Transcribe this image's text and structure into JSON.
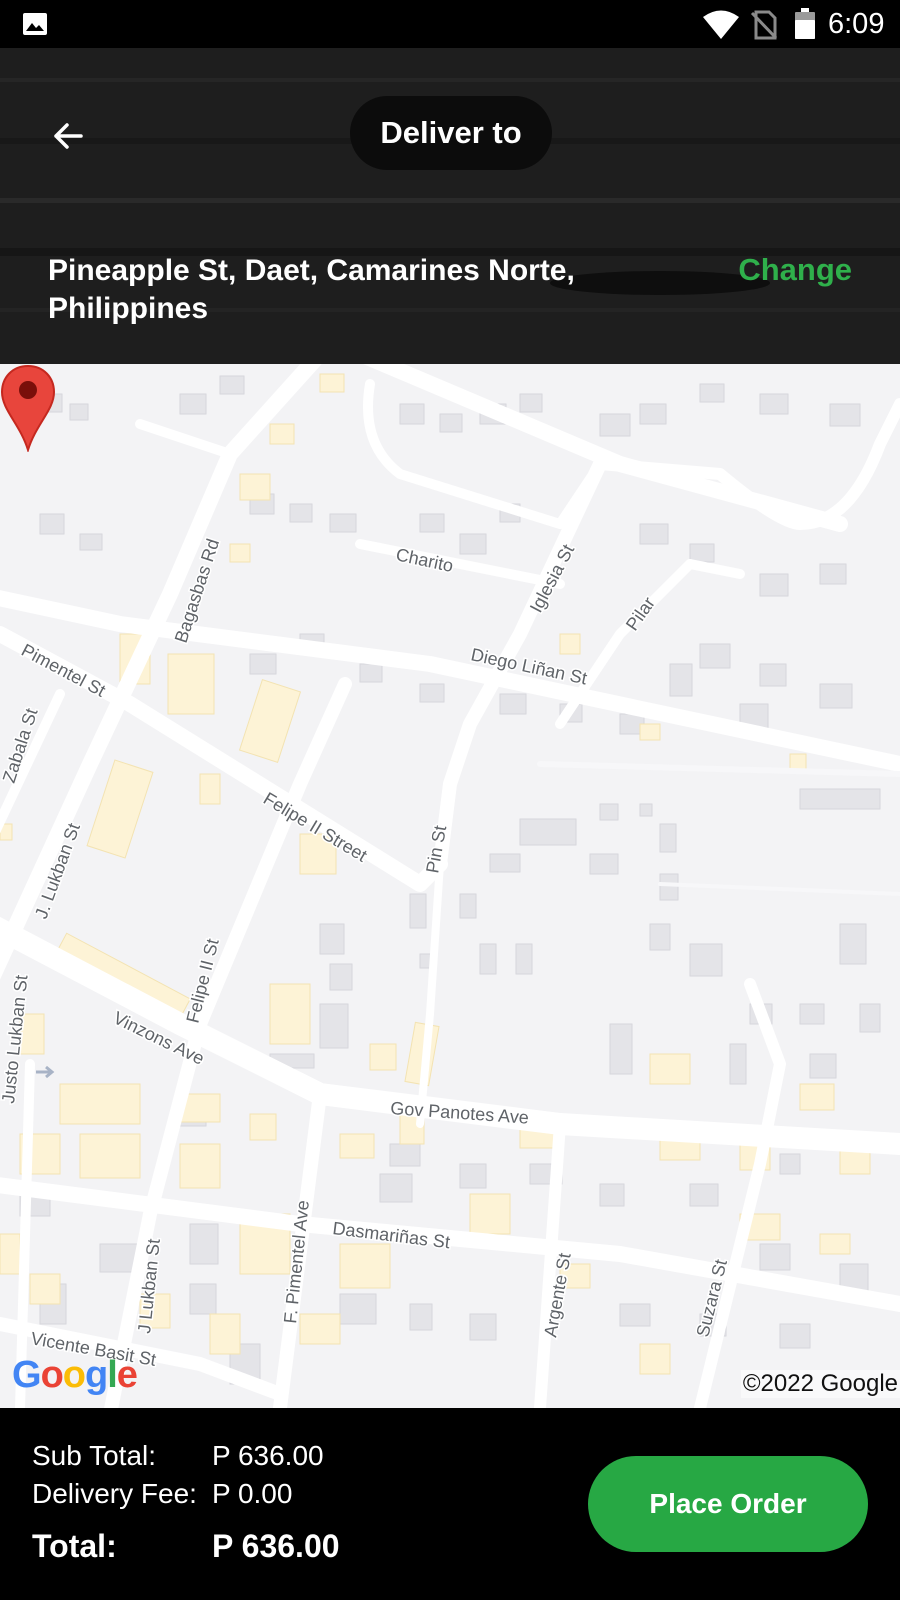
{
  "status_bar": {
    "time": "6:09",
    "icons": [
      "gallery-icon",
      "wifi-icon",
      "no-sim-icon",
      "battery-icon"
    ]
  },
  "header": {
    "title": "Deliver to",
    "back_icon": "arrow-left-icon",
    "address": "Pineapple St, Daet, Camarines Norte, Philippines",
    "change_label": "Change"
  },
  "map": {
    "street_labels": {
      "bagasbas": "Bagasbas Rd",
      "charito": "Charito",
      "iglesia": "Iglesia St",
      "pilar": "Pilar",
      "pimentel": "Pimentel St",
      "diego": "Diego Liñan St",
      "zabala": "Zabala St",
      "jlukban": "J. Lukban St",
      "felipe_street": "Felipe II Street",
      "pineapple": "Pin St",
      "felipe_st": "Felipe II St",
      "justo": "Justo Lukban St",
      "vinzons": "Vinzons Ave",
      "gov_panotes": "Gov Panotes Ave",
      "dasmarinas": "Dasmariñas St",
      "j_lukban2": "J Lukban St",
      "f_pimentel": "F. Pimentel Ave",
      "argente": "Argente St",
      "suzara": "Suzara St",
      "vicente": "Vicente Basit St"
    },
    "logo": "Google",
    "copyright": "©2022 Google",
    "pin_icon": "map-pin-icon"
  },
  "summary": {
    "subtotal_label": "Sub Total:",
    "subtotal_value": "P 636.00",
    "fee_label": "Delivery Fee:",
    "fee_value": "P 0.00",
    "total_label": "Total:",
    "total_value": "P 636.00",
    "place_order_label": "Place Order"
  },
  "colors": {
    "accent": "#27a844",
    "change_link": "#2fb04b",
    "pin": "#e8453c",
    "map_bg": "#f3f3f5",
    "building": "#e6e6ea",
    "commercial": "#fdf4d9"
  }
}
